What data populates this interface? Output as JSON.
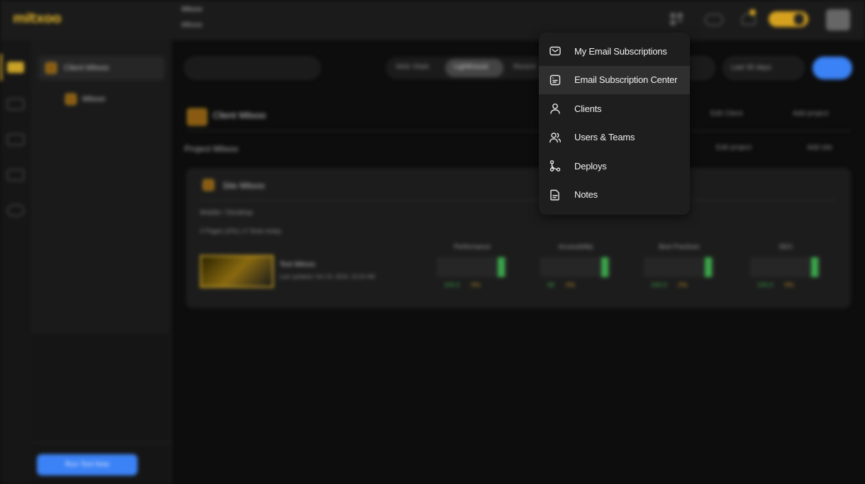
{
  "header": {
    "logo": "mitxoo",
    "workspace_label": "Mitxoo",
    "workspace_select": "Mitxoo"
  },
  "tree": {
    "root_item": "Client Mitxoo",
    "child_item": "Mitxoo",
    "footer_button": "Run Test Now"
  },
  "toolbar": {
    "segments": [
      "Web Vitals",
      "Lighthouse",
      "Recent"
    ],
    "filter_pill": "Last 30 days"
  },
  "client_header": {
    "title": "Client Mitxoo",
    "actions": [
      "Edit Client",
      "Add project"
    ]
  },
  "project_row": {
    "title": "Project Mitxoo",
    "actions": [
      "Edit project",
      "Add site"
    ]
  },
  "site_card": {
    "name": "Site Mitxoo",
    "subtitle": "Mobile / Desktop",
    "counts": "0 Pages (0%) | 0 Tests today",
    "test_name": "Test Mitxoo",
    "test_meta": "Last updated: Oct 10, 2024, 10:24 AM",
    "metrics": [
      {
        "label": "Performance",
        "score": "100.0",
        "change": "0%"
      },
      {
        "label": "Accessibility",
        "score": "96",
        "change": "0%"
      },
      {
        "label": "Best Practices",
        "score": "100.0",
        "change": "0%"
      },
      {
        "label": "SEO",
        "score": "100.0",
        "change": "0%"
      }
    ]
  },
  "menu": {
    "items": [
      {
        "label": "My Email Subscriptions",
        "icon": "mail-icon"
      },
      {
        "label": "Email Subscription Center",
        "icon": "document-list-icon"
      },
      {
        "label": "Clients",
        "icon": "user-icon"
      },
      {
        "label": "Users & Teams",
        "icon": "users-icon"
      },
      {
        "label": "Deploys",
        "icon": "git-branch-icon"
      },
      {
        "label": "Notes",
        "icon": "note-icon"
      }
    ],
    "highlighted_index": 1
  },
  "colors": {
    "accent": "#c9a227",
    "primary": "#3b82f6",
    "menu_bg": "#1e1e1e",
    "menu_highlight": "#2f2f2f"
  }
}
